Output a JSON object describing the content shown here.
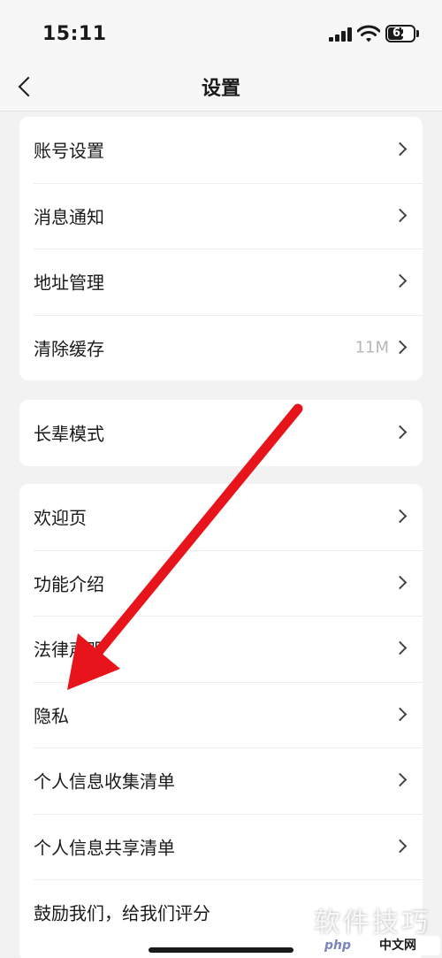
{
  "status_bar": {
    "time": "15:11",
    "battery": "62",
    "battery_level": 0.62,
    "icons": [
      "signal-icon",
      "wifi-icon",
      "battery-icon"
    ]
  },
  "nav": {
    "title": "设置",
    "back_icon": "chevron-left-icon"
  },
  "groups": [
    {
      "items": [
        {
          "label": "账号设置",
          "value": ""
        },
        {
          "label": "消息通知",
          "value": ""
        },
        {
          "label": "地址管理",
          "value": ""
        },
        {
          "label": "清除缓存",
          "value": "11M"
        }
      ]
    },
    {
      "items": [
        {
          "label": "长辈模式",
          "value": ""
        }
      ]
    },
    {
      "items": [
        {
          "label": "欢迎页",
          "value": ""
        },
        {
          "label": "功能介绍",
          "value": ""
        },
        {
          "label": "法律声明",
          "value": ""
        },
        {
          "label": "隐私",
          "value": ""
        },
        {
          "label": "个人信息收集清单",
          "value": ""
        },
        {
          "label": "个人信息共享清单",
          "value": ""
        },
        {
          "label": "鼓励我们，给我们评分",
          "value": ""
        }
      ]
    }
  ],
  "annotation": {
    "color": "#e8141b",
    "points_to": "隐私"
  },
  "watermark": {
    "text": "软件技巧",
    "logo_php": "php",
    "logo_cn": "中文网"
  },
  "colors": {
    "background": "#f2f2f2",
    "card": "#ffffff",
    "secondary_text": "#b8b8b8"
  }
}
